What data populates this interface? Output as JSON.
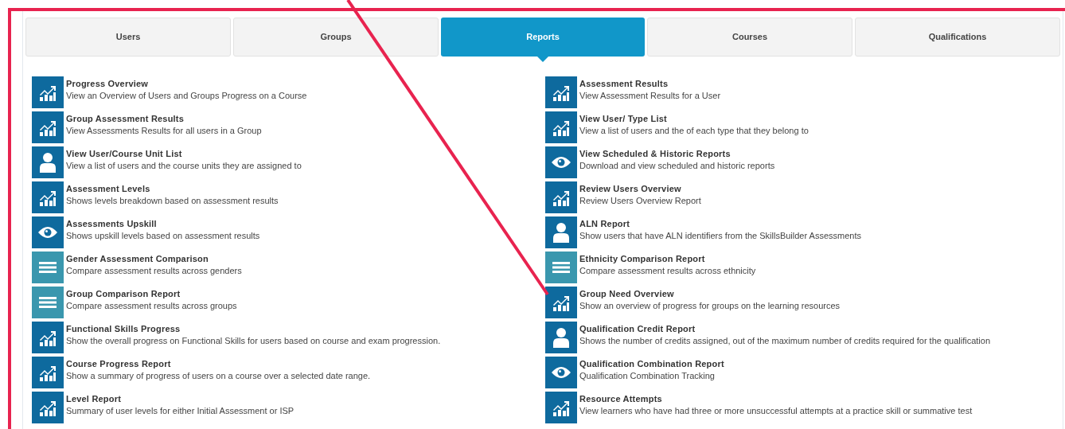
{
  "tabs": [
    {
      "label": "Users",
      "selected": false
    },
    {
      "label": "Groups",
      "selected": false
    },
    {
      "label": "Reports",
      "selected": true
    },
    {
      "label": "Courses",
      "selected": false
    },
    {
      "label": "Qualifications",
      "selected": false
    }
  ],
  "reports": {
    "left": [
      {
        "kind": "chart",
        "title": "Progress Overview",
        "description": "View an Overview of Users and Groups Progress on a Course"
      },
      {
        "kind": "chart",
        "title": "Group Assessment Results",
        "description": "View Assessments Results for all users in a Group"
      },
      {
        "kind": "person",
        "title": "View User/Course Unit List",
        "description": "View a list of users and the course units they are assigned to"
      },
      {
        "kind": "chart",
        "title": "Assessment Levels",
        "description": "Shows levels breakdown based on assessment results"
      },
      {
        "kind": "eye",
        "title": "Assessments Upskill",
        "description": "Shows upskill levels based on assessment results"
      },
      {
        "kind": "list",
        "title": "Gender Assessment Comparison",
        "description": "Compare assessment results across genders"
      },
      {
        "kind": "list",
        "title": "Group Comparison Report",
        "description": "Compare assessment results across groups"
      },
      {
        "kind": "chart",
        "title": "Functional Skills Progress",
        "description": "Show the overall progress on Functional Skills for users based on course and exam progression."
      },
      {
        "kind": "chart",
        "title": "Course Progress Report",
        "description": "Show a summary of progress of users on a course over a selected date range."
      },
      {
        "kind": "chart",
        "title": "Level Report",
        "description": "Summary of user levels for either Initial Assessment or ISP"
      }
    ],
    "right": [
      {
        "kind": "chart",
        "title": "Assessment Results",
        "description": "View Assessment Results for a User"
      },
      {
        "kind": "chart",
        "title": "View User/ Type List",
        "description": "View a list of users and the of each type that they belong to"
      },
      {
        "kind": "eye",
        "title": "View Scheduled & Historic Reports",
        "description": "Download and view scheduled and historic reports"
      },
      {
        "kind": "chart",
        "title": "Review Users Overview",
        "description": "Review Users Overview Report"
      },
      {
        "kind": "person",
        "title": "ALN Report",
        "description": "Show users that have ALN identifiers from the SkillsBuilder Assessments"
      },
      {
        "kind": "list",
        "title": "Ethnicity Comparison Report",
        "description": "Compare assessment results across ethnicity"
      },
      {
        "kind": "chart",
        "title": "Group Need Overview",
        "description": "Show an overview of progress for groups on the learning resources"
      },
      {
        "kind": "person",
        "title": "Qualification Credit Report",
        "description": "Shows the number of credits assigned, out of the maximum number of credits required for the qualification"
      },
      {
        "kind": "eye",
        "title": "Qualification Combination Report",
        "description": "Qualification Combination Tracking"
      },
      {
        "kind": "chart",
        "title": "Resource Attempts",
        "description": "View learners who have had three or more unsuccessful attempts at a practice skill or summative test"
      }
    ]
  }
}
